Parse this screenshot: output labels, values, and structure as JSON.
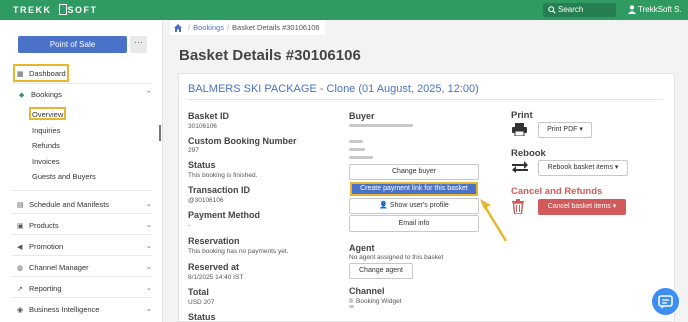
{
  "topbar": {
    "logo_left": "TREKK",
    "logo_right": "SOFT",
    "search_label": "Search",
    "user_name": "TrekkSoft S."
  },
  "sidebar": {
    "pos_button": "Point of Sale",
    "more_button": "···",
    "items": [
      {
        "label": "Dashboard",
        "icon": "grid-icon"
      },
      {
        "label": "Bookings",
        "icon": "tag-icon"
      },
      {
        "label": "Schedule and Manifests",
        "icon": "calendar-icon"
      },
      {
        "label": "Products",
        "icon": "box-icon"
      },
      {
        "label": "Promotion",
        "icon": "megaphone-icon"
      },
      {
        "label": "Channel Manager",
        "icon": "globe-icon"
      },
      {
        "label": "Reporting",
        "icon": "chart-icon"
      },
      {
        "label": "Business Intelligence",
        "icon": "bulb-icon"
      }
    ],
    "bookings_sub": [
      "Overview",
      "Inquiries",
      "Refunds",
      "Invoices",
      "Guests and Buyers"
    ]
  },
  "breadcrumb": {
    "item1": "Bookings",
    "item2": "Basket Details #30106106"
  },
  "page_title": "Basket Details #30106106",
  "package_title": "BALMERS SKI PACKAGE - Clone (01 August, 2025, 12:00)",
  "details": {
    "basket_id_label": "Basket ID",
    "basket_id_value": "30106106",
    "custom_booking_label": "Custom Booking Number",
    "custom_booking_value": "297",
    "status_label": "Status",
    "status_value": "This booking is finished.",
    "transaction_label": "Transaction ID",
    "transaction_value": "@30106106",
    "payment_method_label": "Payment Method",
    "payment_method_value": "-",
    "reservation_label": "Reservation",
    "reservation_value": "This booking has no payments yet.",
    "reserved_at_label": "Reserved at",
    "reserved_at_value": "8/1/2025 14:40 IST",
    "total_label": "Total",
    "total_value": "USD 207",
    "status2_label": "Status"
  },
  "buyer": {
    "label": "Buyer",
    "buttons": [
      "Change buyer",
      "Create payment link for this basket",
      "Show user's profile",
      "Email info"
    ]
  },
  "agent": {
    "label": "Agent",
    "value": "No agent assigned to this basket",
    "button": "Change agent"
  },
  "channel": {
    "label": "Channel",
    "value": "Booking Widget"
  },
  "print": {
    "label": "Print",
    "button": "Print PDF"
  },
  "rebook": {
    "label": "Rebook",
    "button": "Rebook basket items"
  },
  "cancel": {
    "label": "Cancel and Refunds",
    "button": "Cancel basket items"
  },
  "colors": {
    "topbar": "#2f9a62",
    "accent_blue": "#4a72c8",
    "highlight": "#e8b62a",
    "danger": "#d35a5a"
  }
}
